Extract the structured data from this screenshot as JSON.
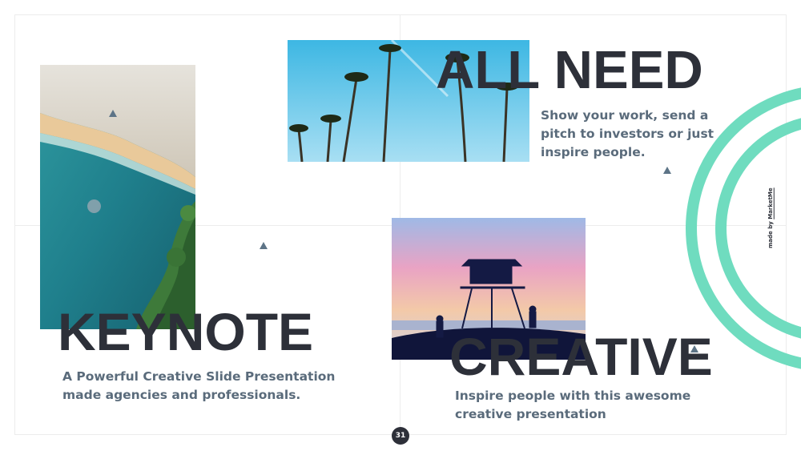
{
  "headings": {
    "all_need": "ALL NEED",
    "keynote": "KEYNOTE",
    "creative": "CREATIVE"
  },
  "descriptions": {
    "all_need": "Show your work, send a pitch to investors or just inspire people.",
    "keynote": "A Powerful Creative Slide Presentation made agencies and professionals.",
    "creative": "Inspire people with this awesome creative presentation"
  },
  "credit": {
    "prefix": "made by ",
    "brand": "MarketMe"
  },
  "page_number": "31",
  "colors": {
    "heading": "#2d3039",
    "body_text": "#5a6b7b",
    "accent_ring": "#6fdcbf",
    "triangle": "#5d7487"
  },
  "photos": {
    "beach": "aerial beach coastline photo",
    "palms": "palm trees against blue sky photo",
    "tower": "lifeguard tower silhouette at sunset photo"
  }
}
